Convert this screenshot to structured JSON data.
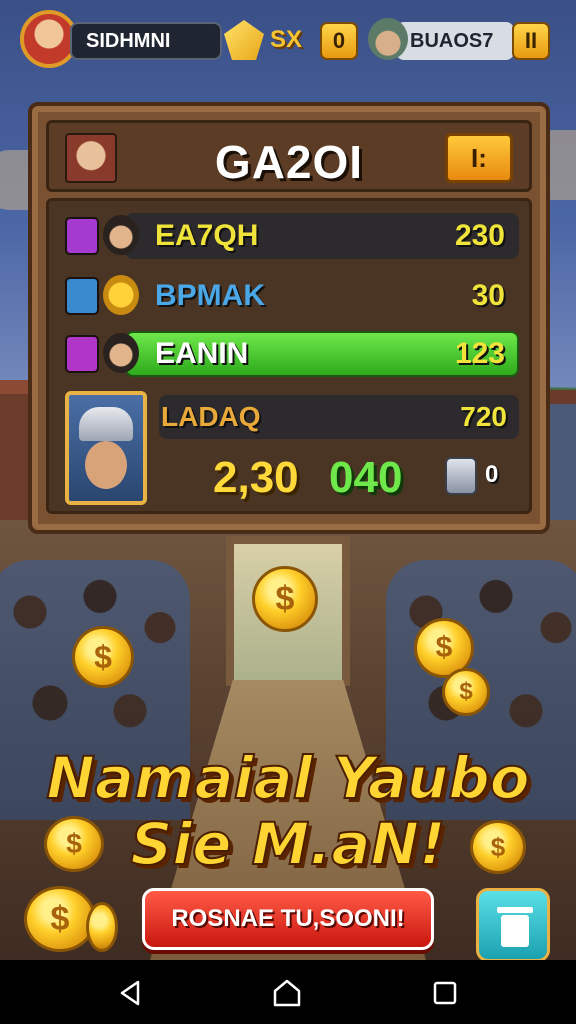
{
  "topbar": {
    "player_name": "SIDHMNI",
    "gem_label": "SX",
    "gem_count": "0",
    "rival_name": "BUAOS7",
    "rival_count": "II"
  },
  "panel": {
    "title": "GA2OI",
    "header_button": "I:",
    "rows": [
      {
        "name": "EA7QH",
        "score": "230"
      },
      {
        "name": "BPMAK",
        "score": "30"
      },
      {
        "name": "EANIN",
        "score": "123"
      }
    ],
    "me": {
      "name": "LADAQ",
      "score": "720",
      "coins": "2,30",
      "gems": "040",
      "lock_count": "0"
    }
  },
  "coins": {
    "symbol": "$"
  },
  "banner": {
    "line1": "Namaial Yaubo",
    "line2": "Sie M.aN!",
    "cta": "ROSNAE TU,SOONI!"
  },
  "colors": {
    "accent_gold": "#ffd534",
    "cta_red": "#d9231a",
    "highlight_green": "#4ccf2e",
    "panel_wood": "#7a5232"
  },
  "icons": [
    "back-icon",
    "home-icon",
    "recent-apps-icon",
    "trash-icon",
    "lock-icon",
    "gem-icon",
    "coin-icon"
  ]
}
